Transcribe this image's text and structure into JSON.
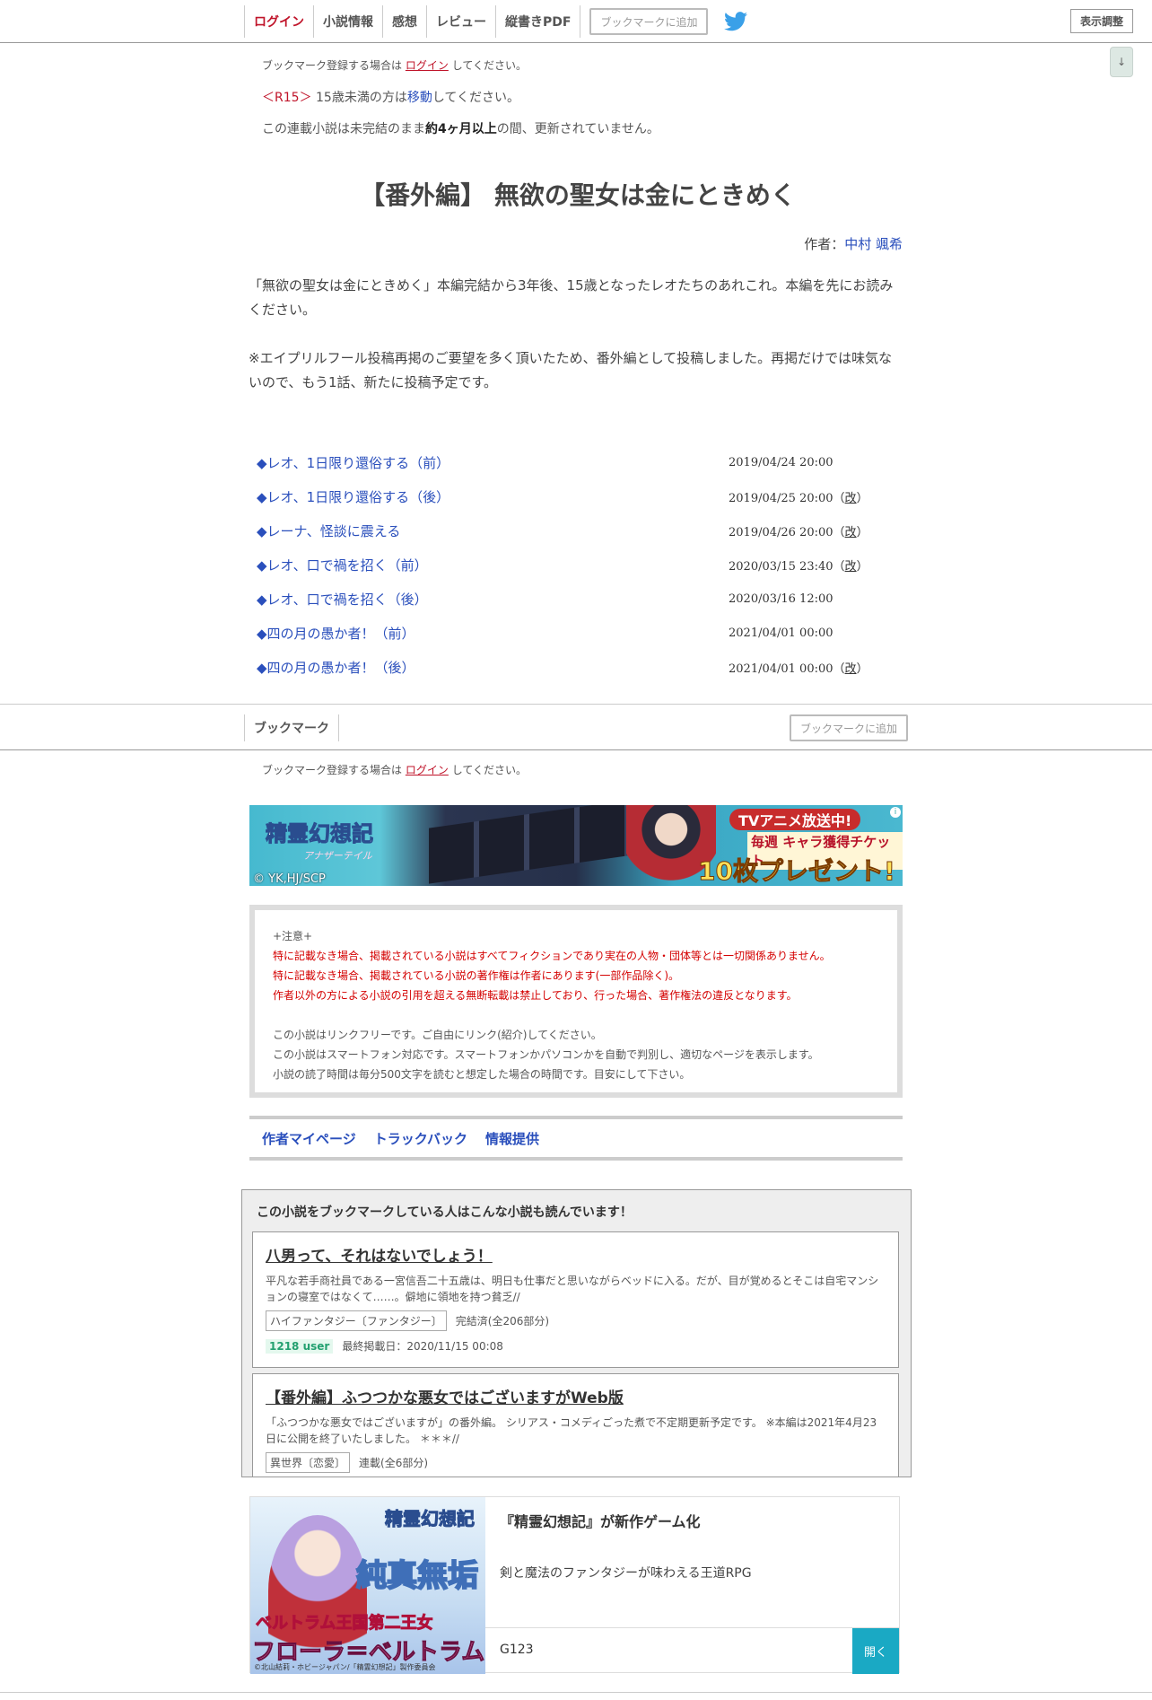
{
  "nav": {
    "items": [
      "ログイン",
      "小説情報",
      "感想",
      "レビュー",
      "縦書きPDF"
    ],
    "bookmark_button": "ブックマークに追加",
    "display_button": "表示調整",
    "scroll_down": "↓"
  },
  "bookmark_note": {
    "prefix": "ブックマーク登録する場合は",
    "link": "ログイン",
    "suffix": "してください。"
  },
  "r15": {
    "tag": "＜R15＞",
    "text": "15歳未満の方は",
    "link": "移動",
    "suffix": "してください。"
  },
  "notice": {
    "prefix": "この連載小説は未完結のまま",
    "bold": "約4ヶ月以上",
    "suffix": "の間、更新されていません。"
  },
  "novel": {
    "title": "【番外編】 無欲の聖女は金にときめく",
    "author_label": "作者：",
    "author": "中村 颯希",
    "synopsis_1": "「無欲の聖女は金にときめく」本編完結から3年後、15歳となったレオたちのあれこれ。本編を先にお読みください。",
    "synopsis_2": "※エイプリルフール投稿再掲のご要望を多く頂いたため、番外編として投稿しました。再掲だけでは味気ないので、もう1話、新たに投稿予定です。"
  },
  "chapters": [
    {
      "title": "◆レオ、1日限り還俗する（前）",
      "date": "2019/04/24 20:00",
      "rev": ""
    },
    {
      "title": "◆レオ、1日限り還俗する（後）",
      "date": "2019/04/25 20:00",
      "rev": "改"
    },
    {
      "title": "◆レーナ、怪談に震える",
      "date": "2019/04/26 20:00",
      "rev": "改"
    },
    {
      "title": "◆レオ、口で禍を招く（前）",
      "date": "2020/03/15 23:40",
      "rev": "改"
    },
    {
      "title": "◆レオ、口で禍を招く（後）",
      "date": "2020/03/16 12:00",
      "rev": ""
    },
    {
      "title": "◆四の月の愚か者！（前）",
      "date": "2021/04/01 00:00",
      "rev": ""
    },
    {
      "title": "◆四の月の愚か者！（後）",
      "date": "2021/04/01 00:00",
      "rev": "改"
    }
  ],
  "bookmark_bar": {
    "label": "ブックマーク",
    "button": "ブックマークに追加"
  },
  "ad_banner": {
    "logo": "精霊幻想記",
    "logo_sub": "アナザーテイル",
    "copyright": "© YK,HJ/SCP",
    "tv": "TVアニメ放送中!",
    "weekly": "毎週 キャラ獲得チケット",
    "ten": "10枚プレゼント!",
    "info": "i"
  },
  "caution": {
    "head": "+注意+",
    "red": [
      "特に記載なき場合、掲載されている小説はすべてフィクションであり実在の人物・団体等とは一切関係ありません。",
      "特に記載なき場合、掲載されている小説の著作権は作者にあります(一部作品除く)。",
      "作者以外の方による小説の引用を超える無断転載は禁止しており、行った場合、著作権法の違反となります。"
    ],
    "normal": [
      "この小説はリンクフリーです。ご自由にリンク(紹介)してください。",
      "この小説はスマートフォン対応です。スマートフォンかパソコンかを自動で判別し、適切なページを表示します。",
      "小説の読了時間は毎分500文字を読むと想定した場合の時間です。目安にして下さい。"
    ]
  },
  "links": [
    "作者マイページ",
    "トラックバック",
    "情報提供"
  ],
  "recommend": {
    "heading": "この小説をブックマークしている人はこんな小説も読んでいます！",
    "items": [
      {
        "title": "八男って、それはないでしょう！",
        "desc": "平凡な若手商社員である一宮信吾二十五歳は、明日も仕事だと思いながらベッドに入る。だが、目が覚めるとそこは自宅マンションの寝室ではなくて……。僻地に領地を持つ貧乏//",
        "genre": "ハイファンタジー〔ファンタジー〕",
        "status": "完結済(全206部分)",
        "users": "1218 user",
        "updated": "最終掲載日：2020/11/15 00:08"
      },
      {
        "title": "【番外編】ふつつかな悪女ではございますがWeb版",
        "desc": "「ふつつかな悪女ではございますが」の番外編。 シリアス・コメディごった煮で不定期更新予定です。 ※本編は2021年4月23日に公開を終了いたしました。 ＊＊＊//",
        "genre": "異世界〔恋愛〕",
        "status": "連載(全6部分)"
      }
    ]
  },
  "ad2": {
    "logo": "精霊幻想記",
    "pure": "純真無垢",
    "princess": "ベルトラム王国第二王女",
    "flora": "フローラ＝ベルトラム",
    "credit": "©北山結莉・ホビージャパン/「精霊幻想記」製作委員会",
    "title": "『精霊幻想記』が新作ゲーム化",
    "desc": "剣と魔法のファンタジーが味わえる王道RPG",
    "sponsor": "G123",
    "open": "開く"
  }
}
